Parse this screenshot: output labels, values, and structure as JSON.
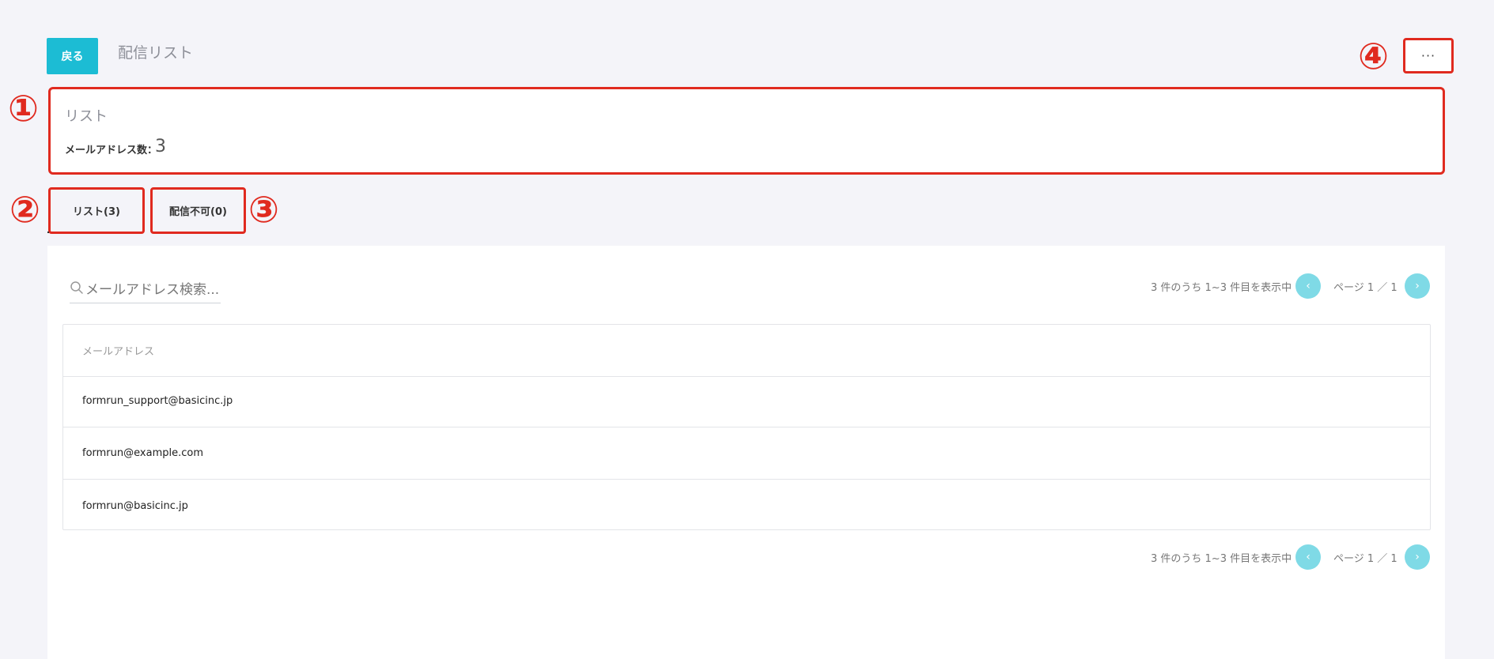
{
  "header": {
    "back_label": "戻る",
    "title": "配信リスト",
    "more_label": "···"
  },
  "markers": [
    "①",
    "②",
    "③",
    "④"
  ],
  "info": {
    "title": "リスト",
    "count_label": "メールアドレス数：",
    "count_value": "3"
  },
  "tabs": [
    {
      "label": "リスト(3)"
    },
    {
      "label": "配信不可(0)"
    }
  ],
  "search": {
    "placeholder": "メールアドレス検索...",
    "icon": "search-icon"
  },
  "pager": {
    "summary": "3 件のうち 1~3 件目を表示中",
    "page_text": "ページ 1 ／ 1",
    "prev_icon": "‹",
    "next_icon": "›"
  },
  "table": {
    "header": "メールアドレス",
    "rows": [
      "formrun_support@basicinc.jp",
      "formrun@example.com",
      "formrun@basicinc.jp"
    ]
  },
  "colors": {
    "accent": "#1cbcd4",
    "pager_button": "#7fdae6",
    "annotation": "#e02a1f",
    "background": "#f4f4f9"
  }
}
